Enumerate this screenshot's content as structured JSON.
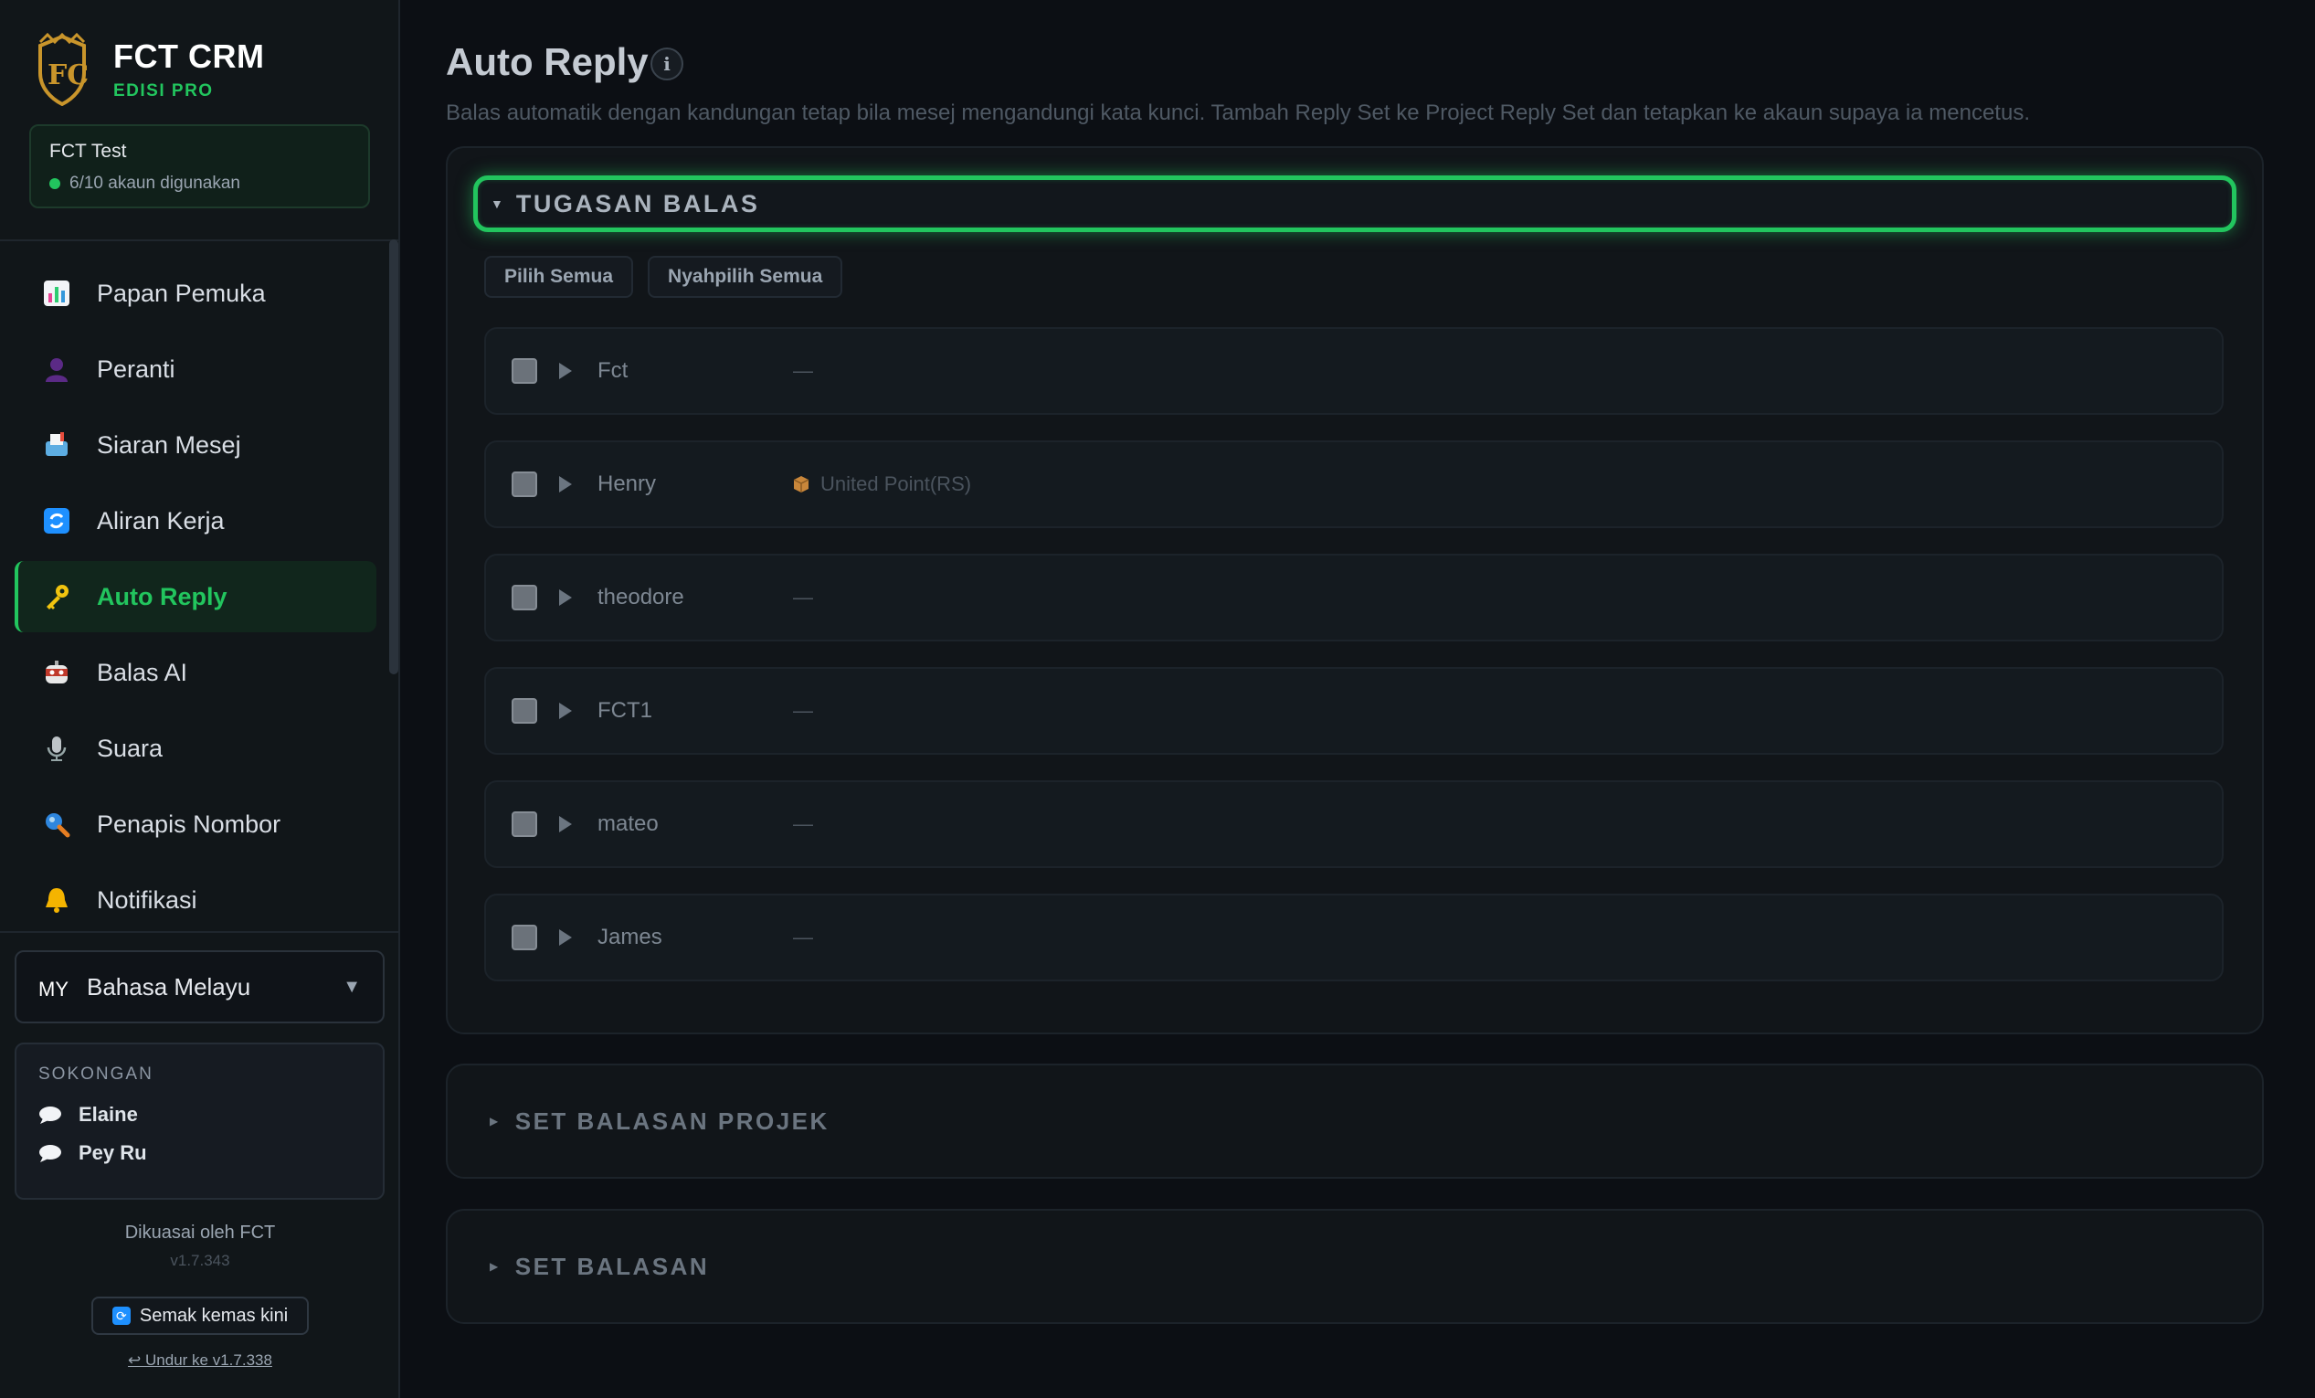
{
  "brand": {
    "title": "FCT CRM",
    "subtitle": "EDISI PRO"
  },
  "account": {
    "name": "FCT Test",
    "usage": "6/10 akaun digunakan"
  },
  "nav": [
    {
      "label": "Papan Pemuka",
      "icon": "bar-chart-icon"
    },
    {
      "label": "Peranti",
      "icon": "person-icon"
    },
    {
      "label": "Siaran Mesej",
      "icon": "inbox-icon"
    },
    {
      "label": "Aliran Kerja",
      "icon": "refresh-icon"
    },
    {
      "label": "Auto Reply",
      "icon": "key-icon"
    },
    {
      "label": "Balas AI",
      "icon": "robot-icon"
    },
    {
      "label": "Suara",
      "icon": "microphone-icon"
    },
    {
      "label": "Penapis Nombor",
      "icon": "magnifier-icon"
    },
    {
      "label": "Notifikasi",
      "icon": "bell-icon"
    }
  ],
  "language": {
    "code": "MY",
    "label": "Bahasa Melayu"
  },
  "support": {
    "title": "SOKONGAN",
    "contacts": [
      "Elaine",
      "Pey Ru"
    ]
  },
  "footer": {
    "powered_by": "Dikuasai oleh FCT",
    "version": "v1.7.343",
    "update_label": "Semak kemas kini",
    "downgrade_label": "↩ Undur ke v1.7.338"
  },
  "page": {
    "title": "Auto Reply",
    "description": "Balas automatik dengan kandungan tetap bila mesej mengandungi kata kunci. Tambah Reply Set ke Project Reply Set dan tetapkan ke akaun supaya ia mencetus."
  },
  "assignments": {
    "title": "TUGASAN BALAS",
    "select_all": "Pilih Semua",
    "deselect_all": "Nyahpilih Semua",
    "rows": [
      {
        "name": "Fct",
        "value": "—"
      },
      {
        "name": "Henry",
        "value": "United Point(RS)"
      },
      {
        "name": "theodore",
        "value": "—"
      },
      {
        "name": "FCT1",
        "value": "—"
      },
      {
        "name": "mateo",
        "value": "—"
      },
      {
        "name": "James",
        "value": "—"
      }
    ]
  },
  "sections": {
    "project_reply_sets": "SET BALASAN PROJEK",
    "reply_sets": "SET BALASAN"
  },
  "colors": {
    "accent": "#22c55e",
    "background": "#0c0f14",
    "sidebar": "#111619"
  }
}
